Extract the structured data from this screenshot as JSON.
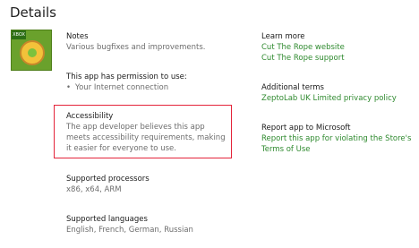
{
  "page": {
    "title": "Details"
  },
  "app_icon": {
    "badge_text": "XBOX",
    "icon": "cut-the-rope-app-icon"
  },
  "left": {
    "notes": {
      "heading": "Notes",
      "text": "Various bugfixes and improvements."
    },
    "permissions": {
      "heading": "This app has permission to use:",
      "items": [
        "Your Internet connection"
      ]
    },
    "accessibility": {
      "heading": "Accessibility",
      "text": "The app developer believes this app meets accessibility requirements, making it easier for everyone to use.",
      "highlight_color": "#e4243a"
    },
    "processors": {
      "heading": "Supported processors",
      "text": "x86, x64, ARM"
    },
    "languages": {
      "heading": "Supported languages",
      "text": "English, French, German, Russian"
    }
  },
  "right": {
    "learn_more": {
      "heading": "Learn more",
      "links": [
        "Cut The Rope website",
        "Cut The Rope support"
      ]
    },
    "additional_terms": {
      "heading": "Additional terms",
      "link": "ZeptoLab UK Limited privacy policy"
    },
    "report": {
      "heading": "Report app to Microsoft",
      "link_line1": "Report this app for violating the Store's",
      "link_line2": "Terms of Use"
    }
  },
  "colors": {
    "link": "#2f8a2f",
    "secondary_text": "#6d6d6d"
  }
}
